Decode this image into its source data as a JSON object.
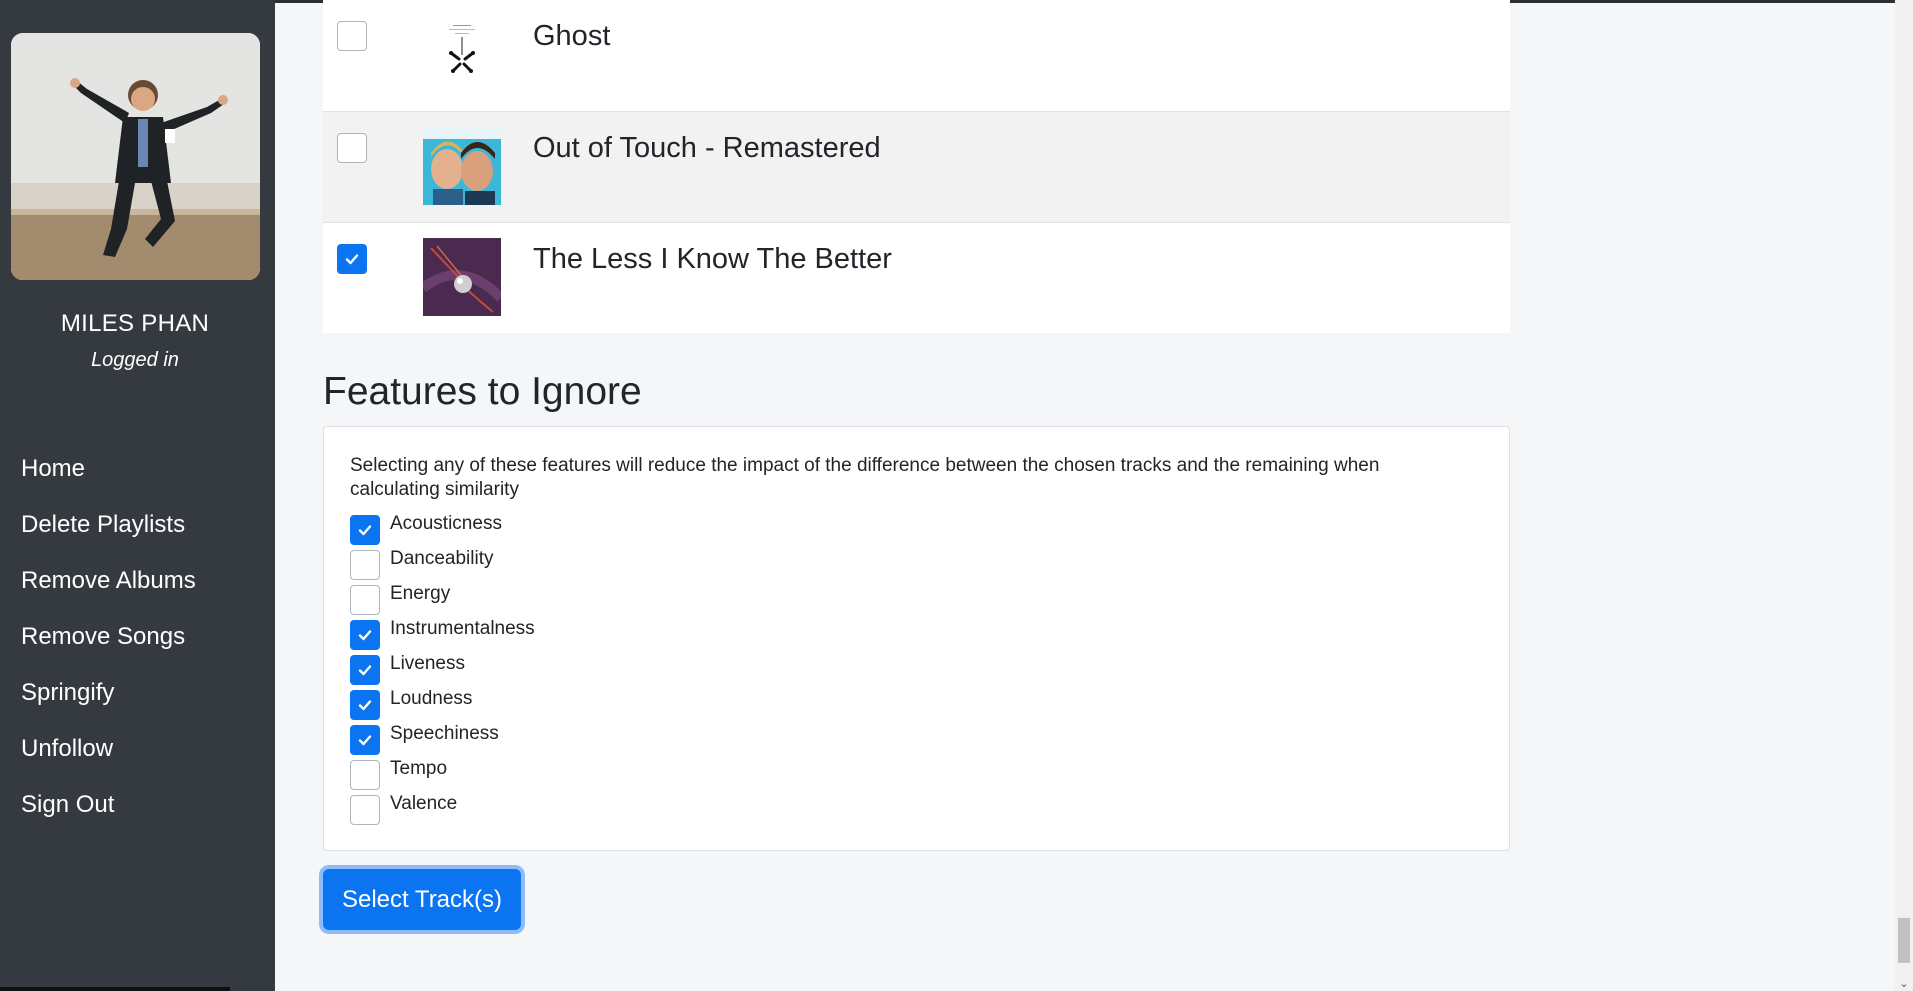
{
  "user": {
    "name": "MILES PHAN",
    "status": "Logged in"
  },
  "nav": {
    "items": [
      {
        "label": "Home"
      },
      {
        "label": "Delete Playlists"
      },
      {
        "label": "Remove Albums"
      },
      {
        "label": "Remove Songs"
      },
      {
        "label": "Springify"
      },
      {
        "label": "Unfollow"
      },
      {
        "label": "Sign Out"
      }
    ]
  },
  "tracks": [
    {
      "title": "Ghost",
      "checked": false
    },
    {
      "title": "Out of Touch - Remastered",
      "checked": false
    },
    {
      "title": "The Less I Know The Better",
      "checked": true
    }
  ],
  "features": {
    "title": "Features to Ignore",
    "description": "Selecting any of these features will reduce the impact of the difference between the chosen tracks and the remaining when calculating similarity",
    "items": [
      {
        "label": "Acousticness",
        "checked": true
      },
      {
        "label": "Danceability",
        "checked": false
      },
      {
        "label": "Energy",
        "checked": false
      },
      {
        "label": "Instrumentalness",
        "checked": true
      },
      {
        "label": "Liveness",
        "checked": true
      },
      {
        "label": "Loudness",
        "checked": true
      },
      {
        "label": "Speechiness",
        "checked": true
      },
      {
        "label": "Tempo",
        "checked": false
      },
      {
        "label": "Valence",
        "checked": false
      }
    ]
  },
  "submit": {
    "label": "Select Track(s)"
  },
  "colors": {
    "sidebar": "#343a40",
    "accent": "#0a74f1",
    "background": "#f5f6f7"
  }
}
